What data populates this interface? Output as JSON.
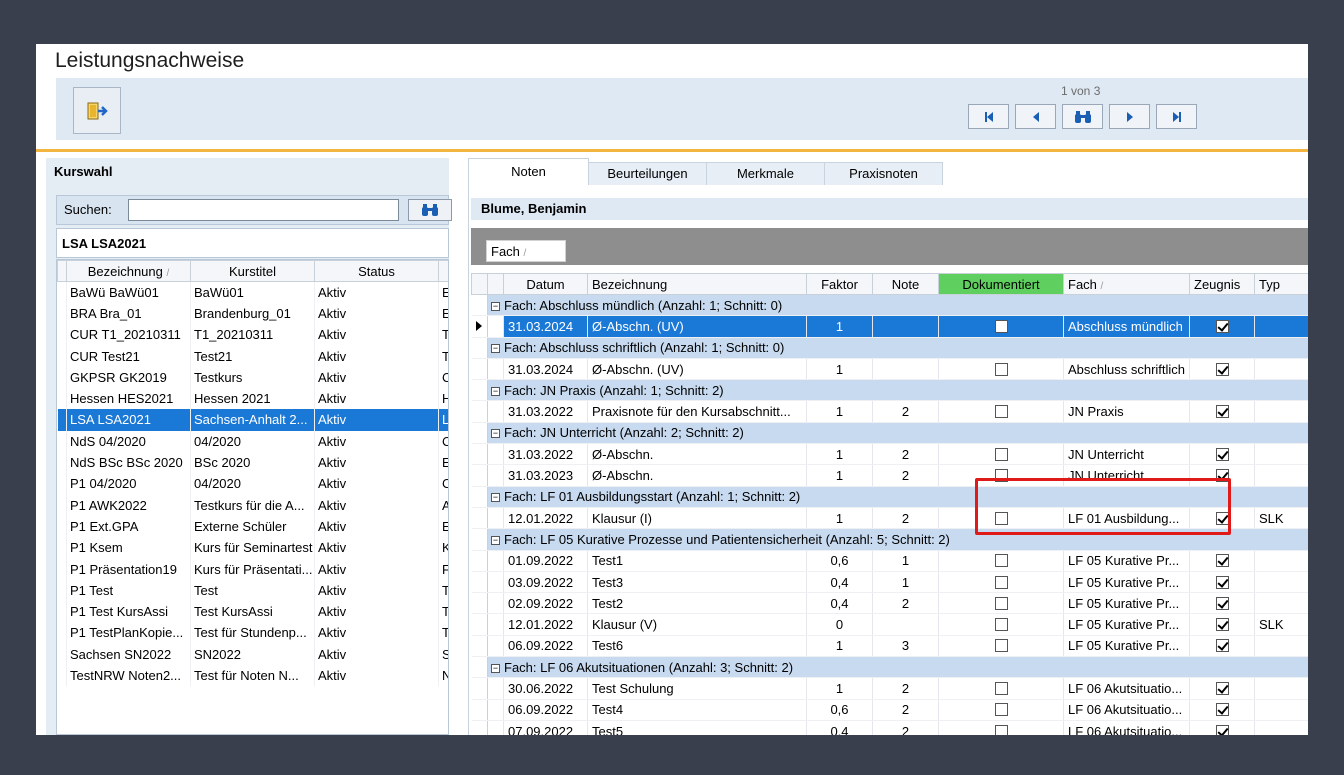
{
  "window": {
    "title": "Leistungsnachweise"
  },
  "toolbar": {
    "exit_icon": "exit-door-icon"
  },
  "pager": {
    "label": "1 von 3",
    "first_icon": "first-page-icon",
    "prev_icon": "prev-page-icon",
    "find_icon": "binoculars-icon",
    "next_icon": "next-page-icon",
    "last_icon": "last-page-icon"
  },
  "kurswahl": {
    "title": "Kurswahl",
    "search_label": "Suchen:",
    "search_value": "",
    "current_course": "LSA LSA2021",
    "columns": [
      "Bezeichnung",
      "Kurstitel",
      "Status"
    ],
    "rows": [
      {
        "bez": "BaWü BaWü01",
        "titel": "BaWü01",
        "status": "Aktiv",
        "x": "E"
      },
      {
        "bez": "BRA Bra_01",
        "titel": "Brandenburg_01",
        "status": "Aktiv",
        "x": "E"
      },
      {
        "bez": "CUR T1_20210311",
        "titel": "T1_20210311",
        "status": "Aktiv",
        "x": "T"
      },
      {
        "bez": "CUR Test21",
        "titel": "Test21",
        "status": "Aktiv",
        "x": "T"
      },
      {
        "bez": "GKPSR GK2019",
        "titel": "Testkurs",
        "status": "Aktiv",
        "x": "C"
      },
      {
        "bez": "Hessen HES2021",
        "titel": "Hessen 2021",
        "status": "Aktiv",
        "x": "H"
      },
      {
        "bez": "LSA LSA2021",
        "titel": "Sachsen-Anhalt 2...",
        "status": "Aktiv",
        "x": "L",
        "selected": true
      },
      {
        "bez": "NdS 04/2020",
        "titel": "04/2020",
        "status": "Aktiv",
        "x": "C"
      },
      {
        "bez": "NdS BSc BSc 2020",
        "titel": "BSc 2020",
        "status": "Aktiv",
        "x": "E"
      },
      {
        "bez": "P1 04/2020",
        "titel": "04/2020",
        "status": "Aktiv",
        "x": "C"
      },
      {
        "bez": "P1 AWK2022",
        "titel": "Testkurs für die A...",
        "status": "Aktiv",
        "x": "A"
      },
      {
        "bez": "P1 Ext.GPA",
        "titel": "Externe Schüler",
        "status": "Aktiv",
        "x": "E"
      },
      {
        "bez": "P1 Ksem",
        "titel": "Kurs für Seminartest",
        "status": "Aktiv",
        "x": "K"
      },
      {
        "bez": "P1 Präsentation19",
        "titel": "Kurs für Präsentati...",
        "status": "Aktiv",
        "x": "F"
      },
      {
        "bez": "P1 Test",
        "titel": "Test",
        "status": "Aktiv",
        "x": "T"
      },
      {
        "bez": "P1 Test KursAssi",
        "titel": "Test KursAssi",
        "status": "Aktiv",
        "x": "T"
      },
      {
        "bez": "P1 TestPlanKopie...",
        "titel": "Test für Stundenp...",
        "status": "Aktiv",
        "x": "T"
      },
      {
        "bez": "Sachsen SN2022",
        "titel": "SN2022",
        "status": "Aktiv",
        "x": "S"
      },
      {
        "bez": "TestNRW Noten2...",
        "titel": "Test für Noten N...",
        "status": "Aktiv",
        "x": "N"
      }
    ]
  },
  "tabs": [
    "Noten",
    "Beurteilungen",
    "Merkmale",
    "Praxisnoten"
  ],
  "student": "Blume, Benjamin",
  "group_chip": "Fach",
  "noten": {
    "columns": [
      "Datum",
      "Bezeichnung",
      "Faktor",
      "Note",
      "Dokumentiert",
      "Fach",
      "Zeugnis",
      "Typ"
    ],
    "groups": [
      {
        "label": "Fach: Abschluss mündlich  (Anzahl: 1;  Schnitt: 0)",
        "rows": [
          {
            "datum": "31.03.2024",
            "bez": "Ø-Abschn. (UV)",
            "faktor": "1",
            "note": "",
            "fach": "Abschluss mündlich",
            "typ": "",
            "selected": true
          }
        ]
      },
      {
        "label": "Fach: Abschluss schriftlich  (Anzahl: 1;  Schnitt: 0)",
        "rows": [
          {
            "datum": "31.03.2024",
            "bez": "Ø-Abschn. (UV)",
            "faktor": "1",
            "note": "",
            "fach": "Abschluss schriftlich",
            "typ": ""
          }
        ]
      },
      {
        "label": "Fach: JN Praxis  (Anzahl: 1;  Schnitt: 2)",
        "rows": [
          {
            "datum": "31.03.2022",
            "bez": "Praxisnote für den Kursabschnitt...",
            "faktor": "1",
            "note": "2",
            "fach": "JN Praxis",
            "typ": ""
          }
        ]
      },
      {
        "label": "Fach: JN Unterricht  (Anzahl: 2;  Schnitt: 2)",
        "rows": [
          {
            "datum": "31.03.2022",
            "bez": "Ø-Abschn.",
            "faktor": "1",
            "note": "2",
            "fach": "JN Unterricht",
            "typ": ""
          },
          {
            "datum": "31.03.2023",
            "bez": "Ø-Abschn.",
            "faktor": "1",
            "note": "2",
            "fach": "JN Unterricht",
            "typ": ""
          }
        ]
      },
      {
        "label": "Fach: LF 01 Ausbildungsstart  (Anzahl: 1;  Schnitt: 2)",
        "rows": [
          {
            "datum": "12.01.2022",
            "bez": "Klausur (I)",
            "faktor": "1",
            "note": "2",
            "fach": "LF 01 Ausbildung...",
            "typ": "SLK"
          }
        ]
      },
      {
        "label": "Fach: LF 05 Kurative Prozesse und Patientensicherheit  (Anzahl: 5;  Schnitt: 2)",
        "rows": [
          {
            "datum": "01.09.2022",
            "bez": "Test1",
            "faktor": "0,6",
            "note": "1",
            "fach": "LF 05 Kurative Pr...",
            "typ": ""
          },
          {
            "datum": "03.09.2022",
            "bez": "Test3",
            "faktor": "0,4",
            "note": "1",
            "fach": "LF 05 Kurative Pr...",
            "typ": ""
          },
          {
            "datum": "02.09.2022",
            "bez": "Test2",
            "faktor": "0,4",
            "note": "2",
            "fach": "LF 05 Kurative Pr...",
            "typ": ""
          },
          {
            "datum": "12.01.2022",
            "bez": "Klausur (V)",
            "faktor": "0",
            "note": "",
            "fach": "LF 05 Kurative Pr...",
            "typ": "SLK"
          },
          {
            "datum": "06.09.2022",
            "bez": "Test6",
            "faktor": "1",
            "note": "3",
            "fach": "LF 05 Kurative Pr...",
            "typ": ""
          }
        ]
      },
      {
        "label": "Fach: LF 06 Akutsituationen  (Anzahl: 3;  Schnitt: 2)",
        "rows": [
          {
            "datum": "30.06.2022",
            "bez": "Test Schulung",
            "faktor": "1",
            "note": "2",
            "fach": "LF 06 Akutsituatio...",
            "typ": ""
          },
          {
            "datum": "06.09.2022",
            "bez": "Test4",
            "faktor": "0,6",
            "note": "2",
            "fach": "LF 06 Akutsituatio...",
            "typ": ""
          },
          {
            "datum": "07.09.2022",
            "bez": "Test5",
            "faktor": "0,4",
            "note": "2",
            "fach": "LF 06 Akutsituatio...",
            "typ": ""
          }
        ]
      }
    ]
  },
  "colors": {
    "accent": "#f2b640",
    "selection": "#1a78d6",
    "group_row": "#c7daf0",
    "dokumentiert_header": "#5fd05f",
    "highlight": "#e01919"
  }
}
